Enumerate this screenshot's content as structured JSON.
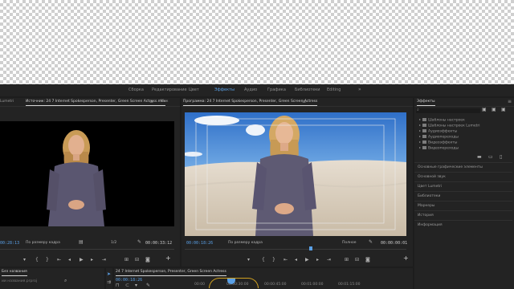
{
  "workspace_tabs": [
    "Сборка",
    "Редактирование",
    "Цвет",
    "Эффекты",
    "Аудио",
    "Графика",
    "Библиотеки",
    "Editing"
  ],
  "active_workspace": "Эффекты",
  "more_glyph": "»",
  "source_monitor": {
    "tab_prefix": "Lumetri",
    "tab_label": "Источник: 24 7 Internet Spokesperson, Presenter, Green Screen Actress.mov",
    "tab_next": "Мик",
    "timecode_left": "00:28:13",
    "fit_label": "По размеру кадра",
    "quality": "1/2",
    "timecode_right": "00:00:33:12"
  },
  "program_monitor": {
    "tab_label": "Программа: 24 7 Internet Spokesperson, Presenter, Green Screen Actress",
    "timecode_left": "00:00:18:26",
    "fit_label": "По размеру кадра",
    "quality": "Полное",
    "timecode_right": "00:00:00:01"
  },
  "project_panel": {
    "tab_label": "Без названия",
    "search_placeholder": "ии названия.prproj"
  },
  "timeline": {
    "tab_label": "24 7 Internet Spokesperson, Presenter, Green Screen Actress",
    "timecode": "00:00:18:26",
    "ruler": [
      "00:00",
      "00:00:30:00",
      "00:00:45:00",
      "00:01:00:00",
      "00:01:15:00"
    ]
  },
  "effects_panel": {
    "title": "Эффекты",
    "tree": [
      "Шаблоны настроек",
      "Шаблоны настроек Lumetri",
      "Аудиоэффекты",
      "Аудиопереходы",
      "Видеоэффекты",
      "Видеопереходы"
    ],
    "side_items": [
      "Основные графические элементы",
      "Основной звук",
      "Цвет Lumetri",
      "Библиотеки",
      "Маркеры",
      "История",
      "Информация"
    ]
  },
  "colors": {
    "accent": "#5aa0e6",
    "panel_bg": "#232323",
    "app_bg": "#1d1d1d"
  }
}
